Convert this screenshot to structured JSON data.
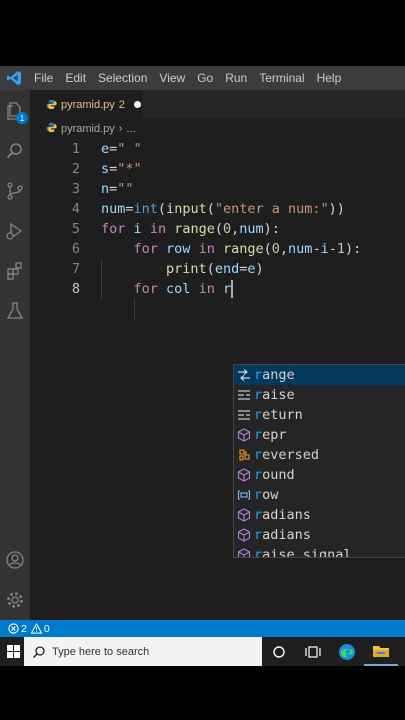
{
  "menubar": {
    "logo_icon": "vscode-logo-icon",
    "items": [
      "File",
      "Edit",
      "Selection",
      "View",
      "Go",
      "Run",
      "Terminal",
      "Help"
    ]
  },
  "activity_bar": {
    "top": [
      {
        "name": "explorer-icon",
        "badge": "1"
      },
      {
        "name": "search-icon"
      },
      {
        "name": "source-control-icon"
      },
      {
        "name": "run-debug-icon"
      },
      {
        "name": "extensions-icon"
      },
      {
        "name": "testing-icon"
      }
    ],
    "bottom": [
      {
        "name": "account-icon"
      },
      {
        "name": "settings-gear-icon"
      }
    ]
  },
  "tab": {
    "filename": "pyramid.py",
    "problem_count": "2",
    "modified": true,
    "file_icon": "python-file-icon"
  },
  "breadcrumb": {
    "file": "pyramid.py",
    "more": "..."
  },
  "editor": {
    "lines": [
      {
        "n": "1",
        "text": "e=\" \""
      },
      {
        "n": "2",
        "text": "s=\"*\""
      },
      {
        "n": "3",
        "text": "n=\"\""
      },
      {
        "n": "4",
        "text": "num=int(input(\"enter a num:\"))"
      },
      {
        "n": "5",
        "text": "for i in range(0,num):"
      },
      {
        "n": "6",
        "text": "    for row in range(0,num-i-1):"
      },
      {
        "n": "7",
        "text": "        print(end=e)"
      },
      {
        "n": "8",
        "text": "    for col in r"
      }
    ],
    "active_line": "8"
  },
  "suggestions": [
    {
      "label": "range",
      "kind": "snippet-icon",
      "selected": true
    },
    {
      "label": "raise",
      "kind": "keyword-icon"
    },
    {
      "label": "return",
      "kind": "keyword-icon"
    },
    {
      "label": "repr",
      "kind": "function-cube-icon"
    },
    {
      "label": "reversed",
      "kind": "class-icon"
    },
    {
      "label": "round",
      "kind": "function-cube-icon"
    },
    {
      "label": "row",
      "kind": "variable-icon"
    },
    {
      "label": "radians",
      "kind": "function-cube-icon"
    },
    {
      "label": "radians",
      "kind": "function-cube-icon"
    },
    {
      "label": "raise_signal",
      "kind": "function-cube-icon"
    }
  ],
  "statusbar": {
    "errors": "2",
    "warnings": "0"
  },
  "taskbar": {
    "search_placeholder": "Type here to search",
    "icons": [
      "windows-start-icon",
      "cortana-circle-icon",
      "task-view-icon",
      "edge-browser-icon",
      "file-explorer-icon"
    ]
  },
  "colors": {
    "accent": "#007acc",
    "keyword": "#569cd6",
    "control_keyword": "#c586c0",
    "function": "#dcdcaa",
    "string": "#ce9178",
    "number": "#b5cea8",
    "match_highlight": "#18a3ff"
  }
}
